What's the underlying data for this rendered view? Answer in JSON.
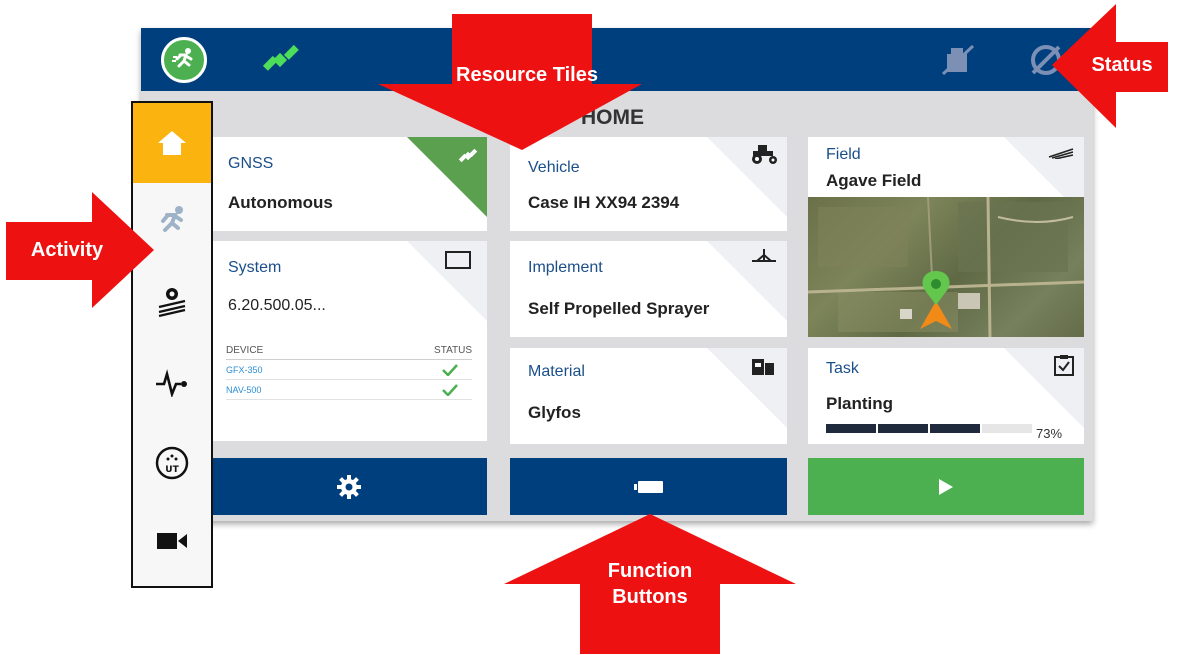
{
  "page_title": "HOME",
  "tiles": {
    "gnss": {
      "label": "GNSS",
      "value": "Autonomous"
    },
    "system": {
      "label": "System",
      "value": "6.20.500.05...",
      "table": {
        "headers": [
          "DEVICE",
          "STATUS"
        ],
        "rows": [
          {
            "device": "GFX-350",
            "status": "ok"
          },
          {
            "device": "NAV-500",
            "status": "ok"
          }
        ]
      }
    },
    "vehicle": {
      "label": "Vehicle",
      "value": "Case IH XX94 2394"
    },
    "implement": {
      "label": "Implement",
      "value": "Self Propelled Sprayer"
    },
    "material": {
      "label": "Material",
      "value": "Glyfos"
    },
    "field": {
      "label": "Field",
      "value": "Agave Field"
    },
    "task": {
      "label": "Task",
      "value": "Planting",
      "progress": 0.73,
      "progress_text": "73%"
    }
  },
  "function_buttons": [
    "settings-icon",
    "battery-icon",
    "play-icon"
  ],
  "sidebar_items": [
    "home-icon",
    "run-icon",
    "machine-settings-icon",
    "heartbeat-icon",
    "ut-icon",
    "camera-icon"
  ],
  "callouts": {
    "resource_tiles": "Resource Tiles",
    "status": "Status",
    "activity": "Activity",
    "function_buttons": "Function Buttons"
  },
  "colors": {
    "topbar": "#003f7d",
    "accent_green": "#4caf50",
    "home_active": "#fbb40f",
    "callout_red": "#ee1111"
  }
}
